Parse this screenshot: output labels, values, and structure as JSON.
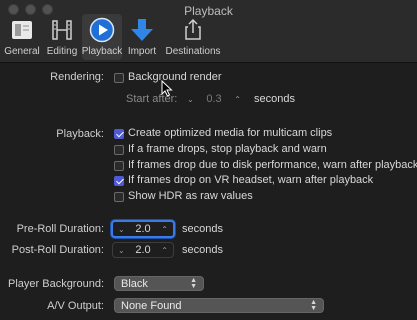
{
  "window": {
    "title": "Playback"
  },
  "toolbar": {
    "items": [
      {
        "label": "General",
        "icon": "general-icon"
      },
      {
        "label": "Editing",
        "icon": "editing-icon"
      },
      {
        "label": "Playback",
        "icon": "playback-icon"
      },
      {
        "label": "Import",
        "icon": "import-icon"
      },
      {
        "label": "Destinations",
        "icon": "destinations-icon"
      }
    ],
    "active": "Playback"
  },
  "rendering": {
    "label": "Rendering:",
    "background_render": {
      "label": "Background render",
      "checked": false
    },
    "start_after": {
      "label": "Start after:",
      "value": "0.3",
      "unit": "seconds"
    }
  },
  "playback": {
    "label": "Playback:",
    "options": [
      {
        "label": "Create optimized media for multicam clips",
        "checked": true
      },
      {
        "label": "If a frame drops, stop playback and warn",
        "checked": false
      },
      {
        "label": "If frames drop due to disk performance, warn after playback",
        "checked": false
      },
      {
        "label": "If frames drop on VR headset, warn after playback",
        "checked": true
      },
      {
        "label": "Show HDR as raw values",
        "checked": false
      }
    ]
  },
  "pre_roll": {
    "label": "Pre-Roll Duration:",
    "value": "2.0",
    "unit": "seconds"
  },
  "post_roll": {
    "label": "Post-Roll Duration:",
    "value": "2.0",
    "unit": "seconds"
  },
  "player_background": {
    "label": "Player Background:",
    "value": "Black"
  },
  "av_output": {
    "label": "A/V Output:",
    "value": "None Found"
  },
  "colors": {
    "accent": "#4f5bd5",
    "focus": "#3b7be8",
    "background": "#1e1e1e"
  }
}
